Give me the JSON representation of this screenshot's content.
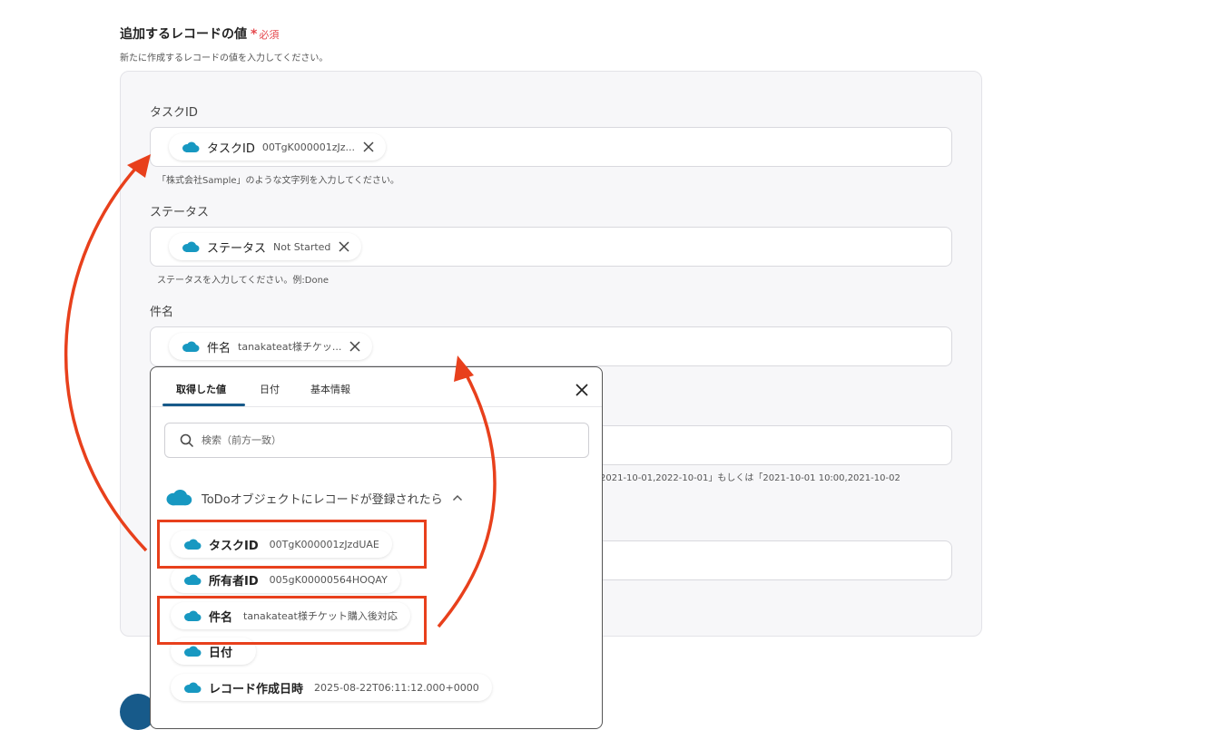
{
  "section": {
    "title": "追加するレコードの値",
    "required_star": "*",
    "required_text": "必須",
    "description": "新たに作成するレコードの値を入力してください。"
  },
  "fields": [
    {
      "label": "タスクID",
      "pill_label": "タスクID",
      "pill_value": "00TgK000001zJz...",
      "hint": "「株式会社Sample」のような文字列を入力してください。"
    },
    {
      "label": "ステータス",
      "pill_label": "ステータス",
      "pill_value": "Not Started",
      "hint": "ステータスを入力してください。例:Done"
    },
    {
      "label": "件名",
      "pill_label": "件名",
      "pill_value": "tanakateat様チケッ..."
    }
  ],
  "date_hint_fragment": "2021-10-01,2022-10-01」もしくは「2021-10-01 10:00,2021-10-02",
  "popup": {
    "tabs": [
      "取得した値",
      "日付",
      "基本情報"
    ],
    "active_tab": 0,
    "search_placeholder": "検索（前方一致）",
    "group_title": "ToDoオブジェクトにレコードが登録されたら",
    "items": [
      {
        "label": "タスクID",
        "value": "00TgK000001zJzdUAE"
      },
      {
        "label": "所有者ID",
        "value": "005gK00000564HOQAY"
      },
      {
        "label": "件名",
        "value": "tanakateat様チケット購入後対応"
      },
      {
        "label": "日付",
        "value": ""
      },
      {
        "label": "レコード作成日時",
        "value": "2025-08-22T06:11:12.000+0000"
      }
    ]
  },
  "colors": {
    "accent": "#175a8a",
    "annotation": "#e8401c",
    "salesforce": "#1798c1",
    "required": "#e5484d"
  },
  "icons": {
    "cloud": "salesforce-cloud-icon",
    "close": "close-icon",
    "search": "search-icon",
    "chevron": "chevron-up-icon"
  }
}
